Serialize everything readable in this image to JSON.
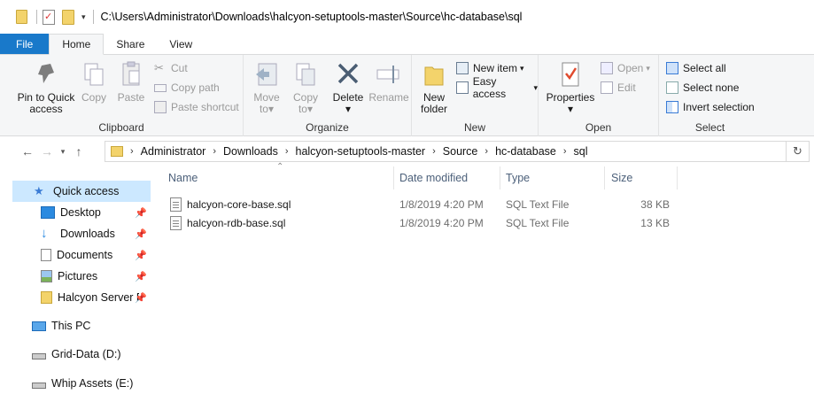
{
  "window": {
    "title_path": "C:\\Users\\Administrator\\Downloads\\halcyon-setuptools-master\\Source\\hc-database\\sql"
  },
  "tabs": [
    "File",
    "Home",
    "Share",
    "View"
  ],
  "ribbon": {
    "clipboard": {
      "label": "Clipboard",
      "pin": "Pin to Quick access",
      "pin_line1": "Pin to Quick",
      "pin_line2": "access",
      "copy": "Copy",
      "paste": "Paste",
      "cut": "Cut",
      "copy_path": "Copy path",
      "paste_shortcut": "Paste shortcut"
    },
    "organize": {
      "label": "Organize",
      "move_to_1": "Move",
      "move_to_2": "to",
      "copy_to_1": "Copy",
      "copy_to_2": "to",
      "delete": "Delete",
      "rename": "Rename"
    },
    "new": {
      "label": "New",
      "new_folder_1": "New",
      "new_folder_2": "folder",
      "new_item": "New item",
      "easy_access": "Easy access"
    },
    "open": {
      "label": "Open",
      "properties": "Properties",
      "open": "Open",
      "edit": "Edit"
    },
    "select": {
      "label": "Select",
      "select_all": "Select all",
      "select_none": "Select none",
      "invert": "Invert selection"
    }
  },
  "breadcrumbs": [
    "Administrator",
    "Downloads",
    "halcyon-setuptools-master",
    "Source",
    "hc-database",
    "sql"
  ],
  "nav_pane": {
    "quick_access": "Quick access",
    "pinned": [
      {
        "label": "Desktop",
        "icon": "desktop-icon"
      },
      {
        "label": "Downloads",
        "icon": "downloads-icon"
      },
      {
        "label": "Documents",
        "icon": "documents-icon"
      },
      {
        "label": "Pictures",
        "icon": "pictures-icon"
      },
      {
        "label": "Halcyon Server F",
        "icon": "folder-icon"
      }
    ],
    "this_pc": "This PC",
    "drives": [
      "Grid-Data (D:)",
      "Whip Assets (E:)"
    ]
  },
  "columns": [
    "Name",
    "Date modified",
    "Type",
    "Size"
  ],
  "files": [
    {
      "name": "halcyon-core-base.sql",
      "date": "1/8/2019 4:20 PM",
      "type": "SQL Text File",
      "size": "38 KB"
    },
    {
      "name": "halcyon-rdb-base.sql",
      "date": "1/8/2019 4:20 PM",
      "type": "SQL Text File",
      "size": "13 KB"
    }
  ],
  "colors": {
    "accent": "#1979ca",
    "selected": "#cce8ff",
    "header_text": "#4c607a"
  }
}
